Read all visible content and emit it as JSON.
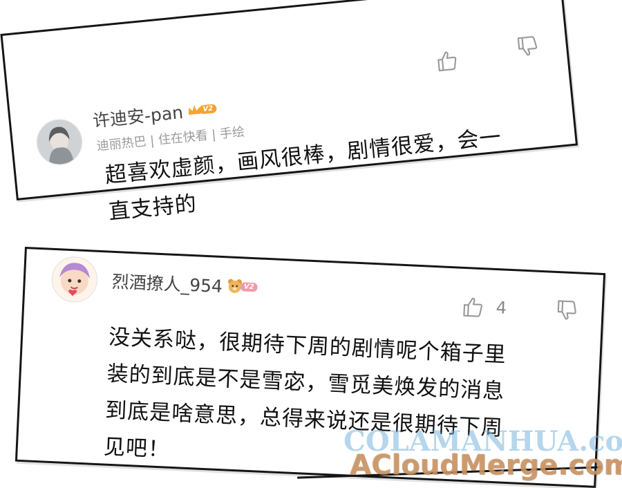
{
  "comments": [
    {
      "username": "许迪安-pan",
      "vip_level": "V2",
      "meta": "迪丽热巴 | 住在快看 | 手绘",
      "text_line1": "超喜欢虚颜，画风很棒，剧情很爱，会一",
      "text_line2": "直支持的",
      "like_icon": "thumbs-up-icon",
      "dislike_icon": "thumbs-down-icon"
    },
    {
      "username": "烈酒撩人_954",
      "vip_level": "V2",
      "like_count": "4",
      "text_line1": "没关系哒，很期待下周的剧情呢个箱子里",
      "text_line2": "装的到底是不是雪宓，雪觅美焕发的消息",
      "text_line3": "到底是啥意思，总得来说还是很期待下周",
      "text_line4": "见吧！",
      "like_icon": "thumbs-up-icon",
      "dislike_icon": "thumbs-down-icon"
    }
  ],
  "watermarks": {
    "line1": "COLAMANHUA.com",
    "line2": "ACloudMerge.com"
  },
  "colors": {
    "border": "#151515",
    "vip_orange": "#f3a531",
    "vip_pink": "#f29aa8",
    "watermark_blue": "#78b4dc",
    "watermark_brown": "#cd9664"
  }
}
